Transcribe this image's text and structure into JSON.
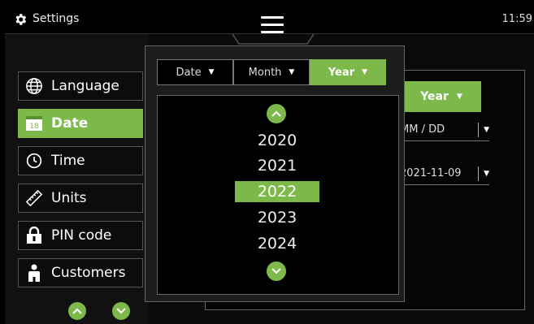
{
  "topbar": {
    "title": "Settings",
    "clock": "11:59",
    "menu_icon": "hamburger-icon",
    "settings_icon": "gear-icon"
  },
  "sidebar": {
    "items": [
      {
        "label": "Language",
        "icon": "globe-icon",
        "active": false
      },
      {
        "label": "Date",
        "icon": "calendar-icon",
        "calendar_day": "18",
        "active": true
      },
      {
        "label": "Time",
        "icon": "clock-icon",
        "active": false
      },
      {
        "label": "Units",
        "icon": "ruler-icon",
        "active": false
      },
      {
        "label": "PIN code",
        "icon": "lock-icon",
        "active": false
      },
      {
        "label": "Customers",
        "icon": "user-icon",
        "active": false
      }
    ],
    "scroll_up_icon": "chevron-up-icon",
    "scroll_down_icon": "chevron-down-icon"
  },
  "content": {
    "year_button": "Year",
    "format_field": "MM / DD",
    "date_field": "2021-11-09"
  },
  "dropdown": {
    "segments": [
      {
        "label": "Date",
        "active": false
      },
      {
        "label": "Month",
        "active": false
      },
      {
        "label": "Year",
        "active": true
      }
    ],
    "years": [
      "2020",
      "2021",
      "2022",
      "2023",
      "2024"
    ],
    "selected_year": "2022"
  },
  "colors": {
    "accent": "#7db84a",
    "background": "#000000",
    "panel": "#1c1c1c"
  }
}
